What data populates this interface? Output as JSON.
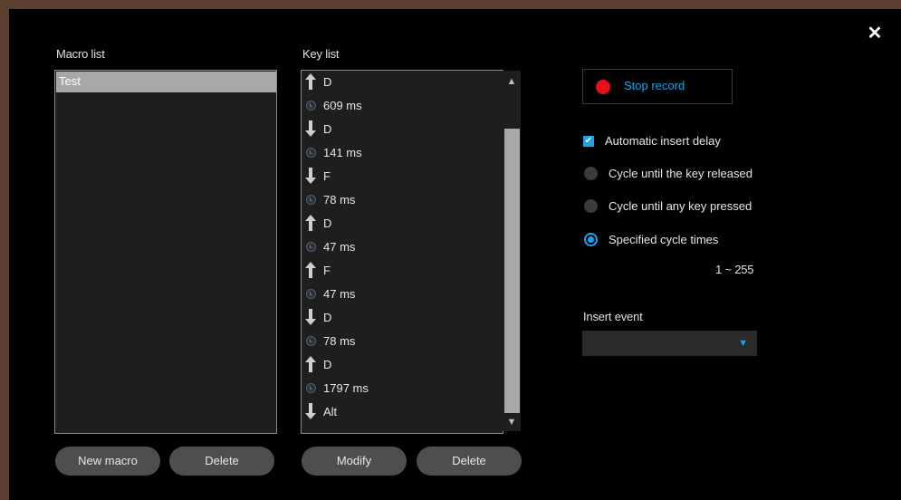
{
  "close_label": "✕",
  "macro_list": {
    "title": "Macro list",
    "items": [
      "Test"
    ]
  },
  "key_list": {
    "title": "Key list",
    "rows": [
      {
        "kind": "up",
        "text": "D"
      },
      {
        "kind": "delay",
        "text": "609 ms"
      },
      {
        "kind": "down",
        "text": "D"
      },
      {
        "kind": "delay",
        "text": "141 ms"
      },
      {
        "kind": "down",
        "text": "F"
      },
      {
        "kind": "delay",
        "text": "78 ms"
      },
      {
        "kind": "up",
        "text": "D"
      },
      {
        "kind": "delay",
        "text": "47 ms"
      },
      {
        "kind": "up",
        "text": "F"
      },
      {
        "kind": "delay",
        "text": "47 ms"
      },
      {
        "kind": "down",
        "text": "D"
      },
      {
        "kind": "delay",
        "text": "78 ms"
      },
      {
        "kind": "up",
        "text": "D"
      },
      {
        "kind": "delay",
        "text": "1797 ms"
      },
      {
        "kind": "down",
        "text": "Alt"
      }
    ]
  },
  "buttons": {
    "new_macro": "New macro",
    "delete_macro": "Delete",
    "modify": "Modify",
    "delete_key": "Delete"
  },
  "record": {
    "label": "Stop record",
    "dot_color": "#e8101a"
  },
  "options": {
    "auto_delay": "Automatic insert delay",
    "cycle_released": "Cycle until the key released",
    "cycle_any": "Cycle until any key pressed",
    "specified": "Specified cycle times",
    "range": "1 ~ 255",
    "auto_delay_checked": true,
    "selected_mode": "specified"
  },
  "insert_event": {
    "title": "Insert event",
    "value": ""
  },
  "accent_color": "#1aa3e8"
}
